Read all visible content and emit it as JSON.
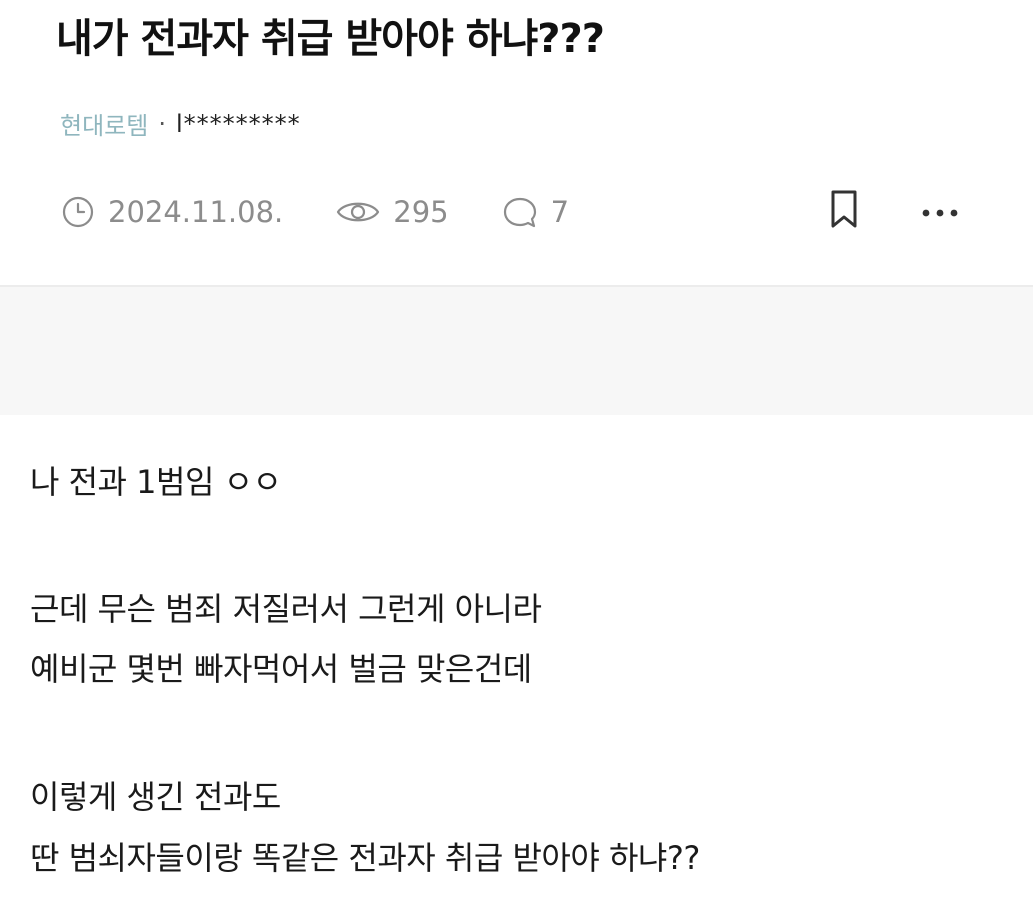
{
  "post": {
    "title": "내가 전과자 취급 받아야 하냐???",
    "company": "현대로템",
    "separator": "·",
    "author": "l*********",
    "date": "2024.11.08.",
    "views": "295",
    "comments": "7"
  },
  "icons": {
    "date": "clock-icon",
    "views": "eye-icon",
    "comments": "comment-bubble-icon",
    "bookmark": "bookmark-icon",
    "more": "more-dots-icon"
  },
  "body": {
    "line1": "나 전과 1범임 ㅇㅇ",
    "line2": "근데 무슨 범죄 저질러서 그런게 아니라",
    "line3": "예비군 몇번 빠자먹어서 벌금 맞은건데",
    "line4": "이렇게 생긴 전과도",
    "line5": "딴 범쇠자들이랑 똑같은 전과자 취급 받아야 하냐??"
  },
  "colors": {
    "company": "#8fb6be",
    "meta": "#8c8c8c",
    "band": "#f7f7f7",
    "text": "#1a1a1a"
  }
}
